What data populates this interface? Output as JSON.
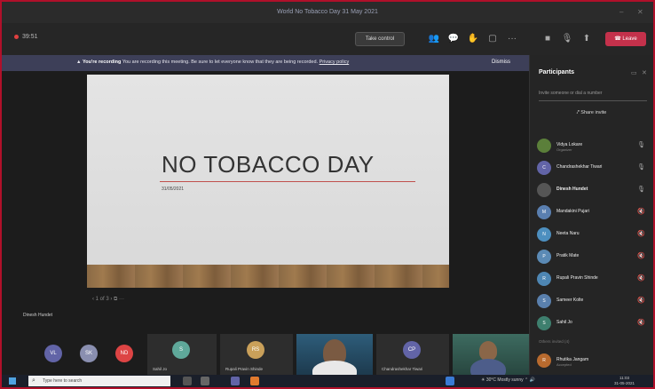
{
  "window": {
    "title": "World No Tobacco Day 31 May 2021"
  },
  "toolbar": {
    "timer": "39:51",
    "take_control_label": "Take control",
    "leave_label": "Leave",
    "icons": [
      "participants-icon",
      "chat-icon",
      "reactions-icon",
      "rooms-icon",
      "more-icon",
      "camera-icon",
      "mic-icon",
      "share-icon"
    ]
  },
  "banner": {
    "bold": "You're recording",
    "message": "You are recording this meeting. Be sure to let everyone know that they are being recorded.",
    "link": "Privacy policy",
    "dismiss_label": "Dismiss"
  },
  "slide": {
    "heading": "NO TOBACCO DAY",
    "date": "31/05/2021"
  },
  "pager": {
    "text": "1 of 3"
  },
  "sharer": {
    "name": "Dinesh Hundet"
  },
  "participants_panel": {
    "title": "Participants",
    "invite_placeholder": "Invite someone or dial a number",
    "share_invite_label": "Share invite",
    "section_label": "In this meeting",
    "people": [
      {
        "initials": "",
        "name": "Vidya Lokare",
        "sub": "Organizer",
        "color": "#5b7f3a"
      },
      {
        "initials": "C",
        "name": "Chandrashekhar Tiwari",
        "sub": "",
        "color": "#6264a7"
      },
      {
        "initials": "",
        "name": "Dinesh Hundet",
        "sub": "",
        "color": "#555555"
      },
      {
        "initials": "M",
        "name": "Mandakini Pujari",
        "sub": "",
        "color": "#5a7fb0"
      },
      {
        "initials": "N",
        "name": "Neeta Naru",
        "sub": "",
        "color": "#4d8fbf"
      },
      {
        "initials": "P",
        "name": "Pratik Mate",
        "sub": "",
        "color": "#5b8ab5"
      },
      {
        "initials": "R",
        "name": "Rupali Pravin Shinde",
        "sub": "",
        "color": "#4e86b3"
      },
      {
        "initials": "S",
        "name": "Sameer Kolte",
        "sub": "",
        "color": "#5a80ad"
      },
      {
        "initials": "S",
        "name": "Sahil Jo",
        "sub": "",
        "color": "#3e7f6e"
      }
    ],
    "others_label": "Others invited (4)",
    "invited": [
      {
        "initials": "R",
        "name": "Rhutika Jangam",
        "sub": "Accepted",
        "color": "#b86a2e"
      }
    ]
  },
  "thumbnails": [
    {
      "initials": "VL",
      "name": "",
      "color": "#6264a7"
    },
    {
      "initials": "SK",
      "name": "",
      "color": "#8a8fb0"
    },
    {
      "initials": "ND",
      "name": "",
      "color": "#d44"
    },
    {
      "initials": "S",
      "name": "Sahil Jo",
      "color": "#5fa89a"
    },
    {
      "initials": "RS",
      "name": "Rupali Pravin Shinde",
      "color": "#c9a05a"
    },
    {
      "initials": "CP",
      "name": "Chandrashekhar Tiwari",
      "color": "#6264a7"
    }
  ],
  "taskbar": {
    "search_placeholder": "Type here to search",
    "tray_text": "30°C Mostly sunny",
    "time": "11:03",
    "date": "31-05-2021"
  }
}
